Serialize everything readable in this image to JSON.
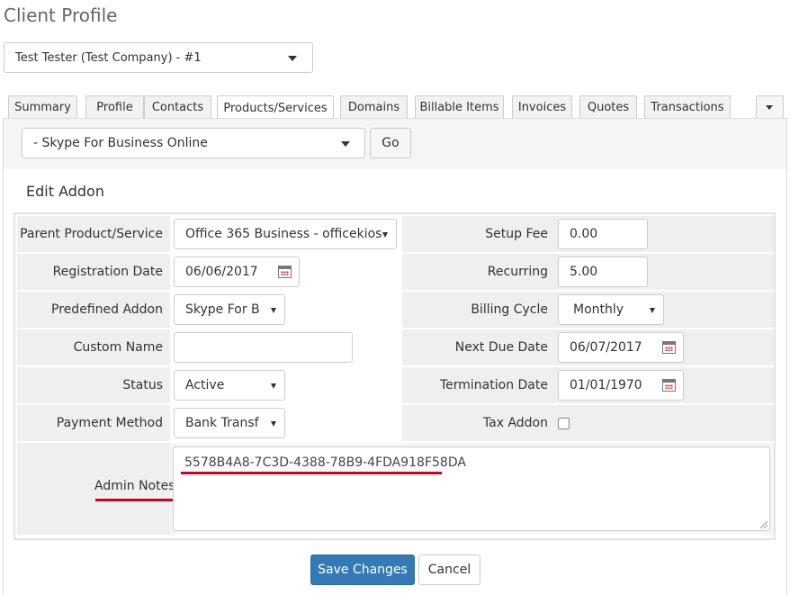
{
  "page_title": "Client Profile",
  "client_select": {
    "value": "Test Tester (Test Company) - #1"
  },
  "tabs": [
    {
      "label": "Summary"
    },
    {
      "label": "Profile"
    },
    {
      "label": "Contacts"
    },
    {
      "label": "Products/Services",
      "active": true
    },
    {
      "label": "Domains"
    },
    {
      "label": "Billable Items"
    },
    {
      "label": "Invoices"
    },
    {
      "label": "Quotes"
    },
    {
      "label": "Transactions"
    }
  ],
  "service_select": {
    "value": "- Skype For Business Online"
  },
  "go_label": "Go",
  "section_title": "Edit Addon",
  "form": {
    "parent_product": {
      "label": "Parent Product/Service",
      "value": "Office 365 Business - officekios"
    },
    "registration_date": {
      "label": "Registration Date",
      "value": "06/06/2017"
    },
    "predefined_addon": {
      "label": "Predefined Addon",
      "value": "Skype For B"
    },
    "custom_name": {
      "label": "Custom Name",
      "value": ""
    },
    "status": {
      "label": "Status",
      "value": "Active"
    },
    "payment_method": {
      "label": "Payment Method",
      "value": "Bank Transf"
    },
    "setup_fee": {
      "label": "Setup Fee",
      "value": "0.00"
    },
    "recurring": {
      "label": "Recurring",
      "value": "5.00"
    },
    "billing_cycle": {
      "label": "Billing Cycle",
      "value": "Monthly"
    },
    "next_due_date": {
      "label": "Next Due Date",
      "value": "06/07/2017"
    },
    "termination_date": {
      "label": "Termination Date",
      "value": "01/01/1970"
    },
    "tax_addon": {
      "label": "Tax Addon",
      "checked": false
    },
    "admin_notes": {
      "label": "Admin Notes",
      "value": "5578B4A8-7C3D-4388-78B9-4FDA918F58DA"
    }
  },
  "buttons": {
    "save": "Save Changes",
    "cancel": "Cancel"
  },
  "colors": {
    "primary": "#337ab7",
    "highlight": "#d0021b",
    "row_bg": "#efefef"
  }
}
